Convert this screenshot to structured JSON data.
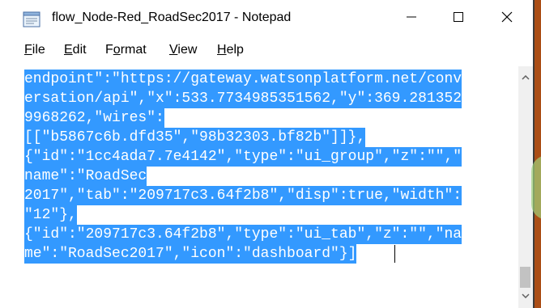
{
  "window": {
    "title": "flow_Node-Red_RoadSec2017 - Notepad"
  },
  "menu": [
    {
      "key": "F",
      "rest": "ile"
    },
    {
      "key": "E",
      "rest": "dit"
    },
    {
      "key": "",
      "pre": "F",
      "key2": "o",
      "rest": "rmat"
    },
    {
      "key": "V",
      "rest": "iew"
    },
    {
      "key": "H",
      "rest": "elp"
    }
  ],
  "editor": {
    "lines": [
      "endpoint\":\"https://gateway.watsonplatform.net/conv",
      "ersation/api\",\"x\":533.7734985351562,\"y\":369.281352",
      "9968262,\"wires\":",
      "[[\"b5867c6b.dfd35\",\"98b32303.bf82b\"]]},",
      "{\"id\":\"1cc4ada7.7e4142\",\"type\":\"ui_group\",\"z\":\"\",\"",
      "name\":\"RoadSec",
      "2017\",\"tab\":\"209717c3.64f2b8\",\"disp\":true,\"width\":",
      "\"12\"},",
      "{\"id\":\"209717c3.64f2b8\",\"type\":\"ui_tab\",\"z\":\"\",\"na",
      "me\":\"RoadSec2017\",\"icon\":\"dashboard\"}]"
    ]
  },
  "colors": {
    "selection": "#3399ff",
    "selection_text": "#ffffff",
    "desktop": "#b5561c"
  },
  "icons": {
    "app": "notepad-icon",
    "minimize": "minimize-icon",
    "maximize": "maximize-icon",
    "close": "close-icon"
  }
}
